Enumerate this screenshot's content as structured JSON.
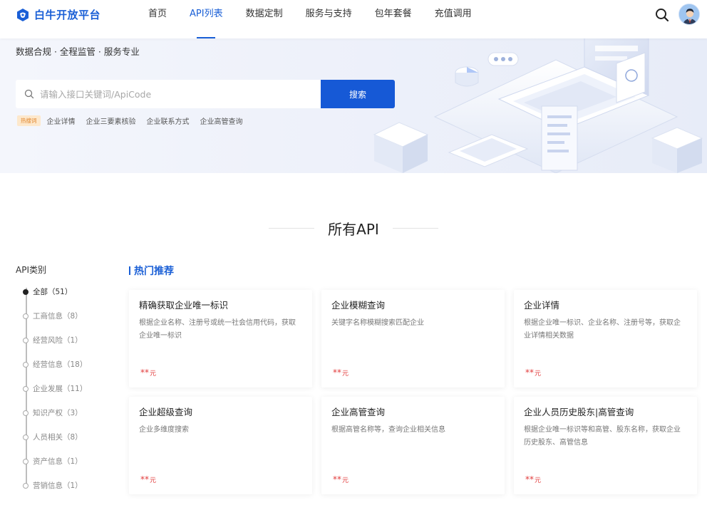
{
  "header": {
    "logo_text": "白牛开放平台",
    "nav": [
      {
        "label": "首页",
        "active": false
      },
      {
        "label": "API列表",
        "active": true
      },
      {
        "label": "数据定制",
        "active": false
      },
      {
        "label": "服务与支持",
        "active": false
      },
      {
        "label": "包年套餐",
        "active": false
      },
      {
        "label": "充值调用",
        "active": false
      }
    ]
  },
  "banner": {
    "slogan": "数据合规 · 全程监管 · 服务专业",
    "search_placeholder": "请输入接口关键词/ApiCode",
    "search_button": "搜索",
    "hot_badge": "热搜词",
    "hot_words": [
      "企业详情",
      "企业三要素核验",
      "企业联系方式",
      "企业高管查询"
    ]
  },
  "section": {
    "title": "所有API"
  },
  "sidebar": {
    "title": "API类别",
    "categories": [
      {
        "label": "全部（51）",
        "active": true
      },
      {
        "label": "工商信息（8）",
        "active": false
      },
      {
        "label": "经营风险（1）",
        "active": false
      },
      {
        "label": "经营信息（18）",
        "active": false
      },
      {
        "label": "企业发展（11）",
        "active": false
      },
      {
        "label": "知识产权（3）",
        "active": false
      },
      {
        "label": "人员相关（8）",
        "active": false
      },
      {
        "label": "资产信息（1）",
        "active": false
      },
      {
        "label": "营销信息（1）",
        "active": false
      }
    ]
  },
  "content": {
    "hot_title": "热门推荐",
    "cards": [
      {
        "name": "精确获取企业唯一标识",
        "desc": "根据企业名称、注册号或统一社会信用代码，获取企业唯一标识",
        "price": "**",
        "unit": "元"
      },
      {
        "name": "企业模糊查询",
        "desc": "关键字名称模糊搜索匹配企业",
        "price": "**",
        "unit": "元"
      },
      {
        "name": "企业详情",
        "desc": "根据企业唯一标识、企业名称、注册号等，获取企业详情相关数据",
        "price": "**",
        "unit": "元"
      },
      {
        "name": "企业超级查询",
        "desc": "企业多维度搜索",
        "price": "**",
        "unit": "元"
      },
      {
        "name": "企业高管查询",
        "desc": "根据高管名称等，查询企业相关信息",
        "price": "**",
        "unit": "元"
      },
      {
        "name": "企业人员历史股东|高管查询",
        "desc": "根据企业唯一标识等和高管、股东名称，获取企业历史股东、高管信息",
        "price": "**",
        "unit": "元"
      }
    ]
  },
  "colors": {
    "brand": "#1a5fd6",
    "button": "#1659d6",
    "price": "#e23b3b",
    "hot_badge_bg": "#fde8cc"
  }
}
